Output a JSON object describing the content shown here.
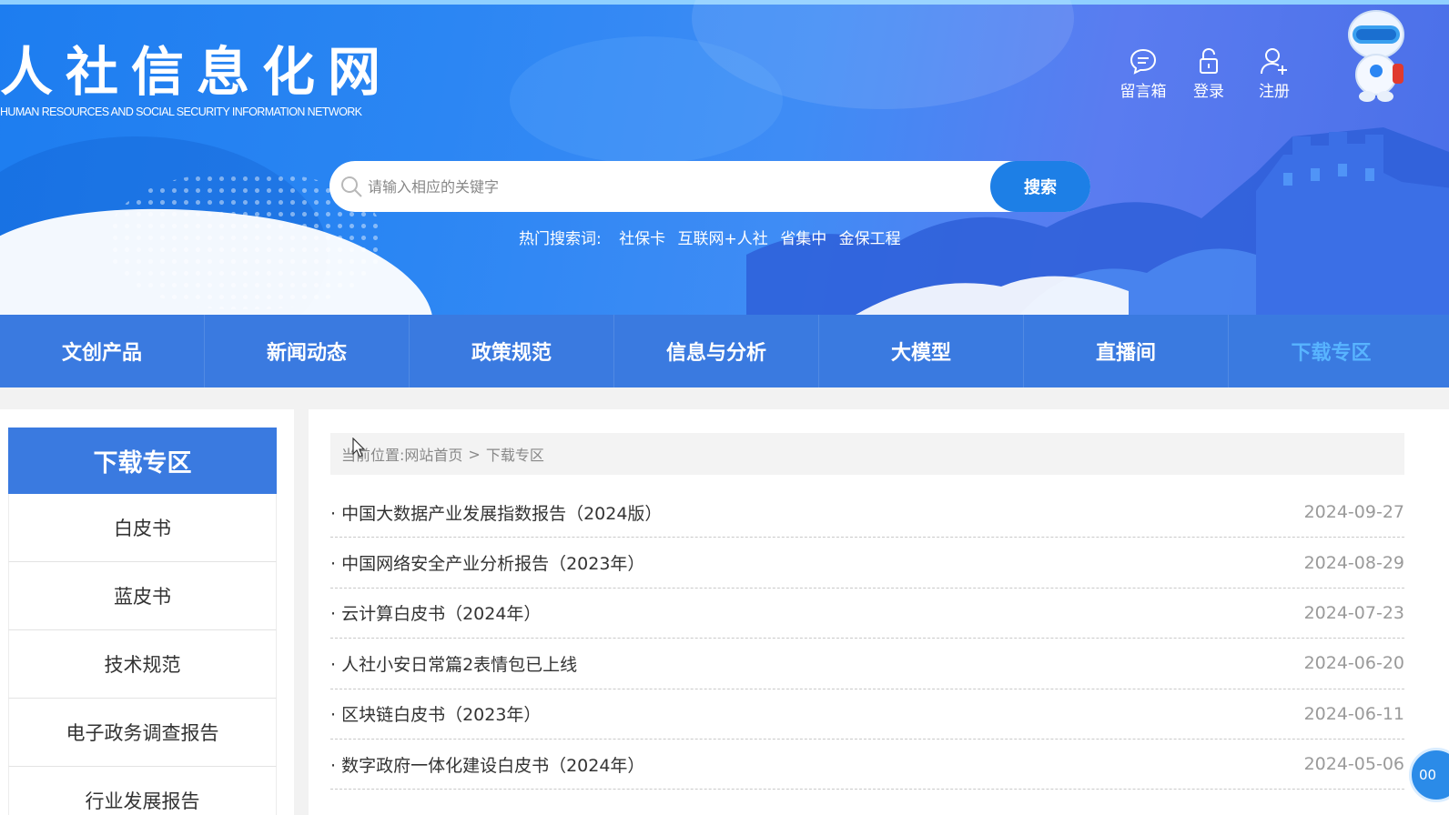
{
  "header": {
    "site_title": "人社信息化网",
    "site_subtitle": "HUMAN RESOURCES AND SOCIAL SECURITY INFORMATION NETWORK",
    "actions": [
      {
        "label": "留言箱",
        "icon": "message-icon"
      },
      {
        "label": "登录",
        "icon": "lock-icon"
      },
      {
        "label": "注册",
        "icon": "add-user-icon"
      }
    ]
  },
  "search": {
    "placeholder": "请输入相应的关键字",
    "value": "",
    "button_label": "搜索",
    "hot_label": "热门搜索词:",
    "hot_terms": [
      "社保卡",
      "互联网+人社",
      "省集中",
      "金保工程"
    ]
  },
  "nav": {
    "items": [
      "文创产品",
      "新闻动态",
      "政策规范",
      "信息与分析",
      "大模型",
      "直播间",
      "下载专区"
    ],
    "active_index": 6
  },
  "sidebar": {
    "title": "下载专区",
    "items": [
      "白皮书",
      "蓝皮书",
      "技术规范",
      "电子政务调查报告",
      "行业发展报告"
    ]
  },
  "breadcrumb": {
    "prefix": "当前位置:",
    "home": "网站首页",
    "separator": ">",
    "current": "下载专区"
  },
  "articles": [
    {
      "title": "· 中国大数据产业发展指数报告（2024版）",
      "date": "2024-09-27"
    },
    {
      "title": "· 中国网络安全产业分析报告（2023年）",
      "date": "2024-08-29"
    },
    {
      "title": "· 云计算白皮书（2024年）",
      "date": "2024-07-23"
    },
    {
      "title": "· 人社小安日常篇2表情包已上线",
      "date": "2024-06-20"
    },
    {
      "title": "· 区块链白皮书（2023年）",
      "date": "2024-06-11"
    },
    {
      "title": "· 数字政府一体化建设白皮书（2024年）",
      "date": "2024-05-06"
    }
  ],
  "float_button": {
    "label": "00"
  },
  "colors": {
    "nav_bg": "#3a7ae0",
    "nav_active": "#58b4ff",
    "search_button": "#1d7fe6",
    "banner_blue": "#2b86f3"
  }
}
